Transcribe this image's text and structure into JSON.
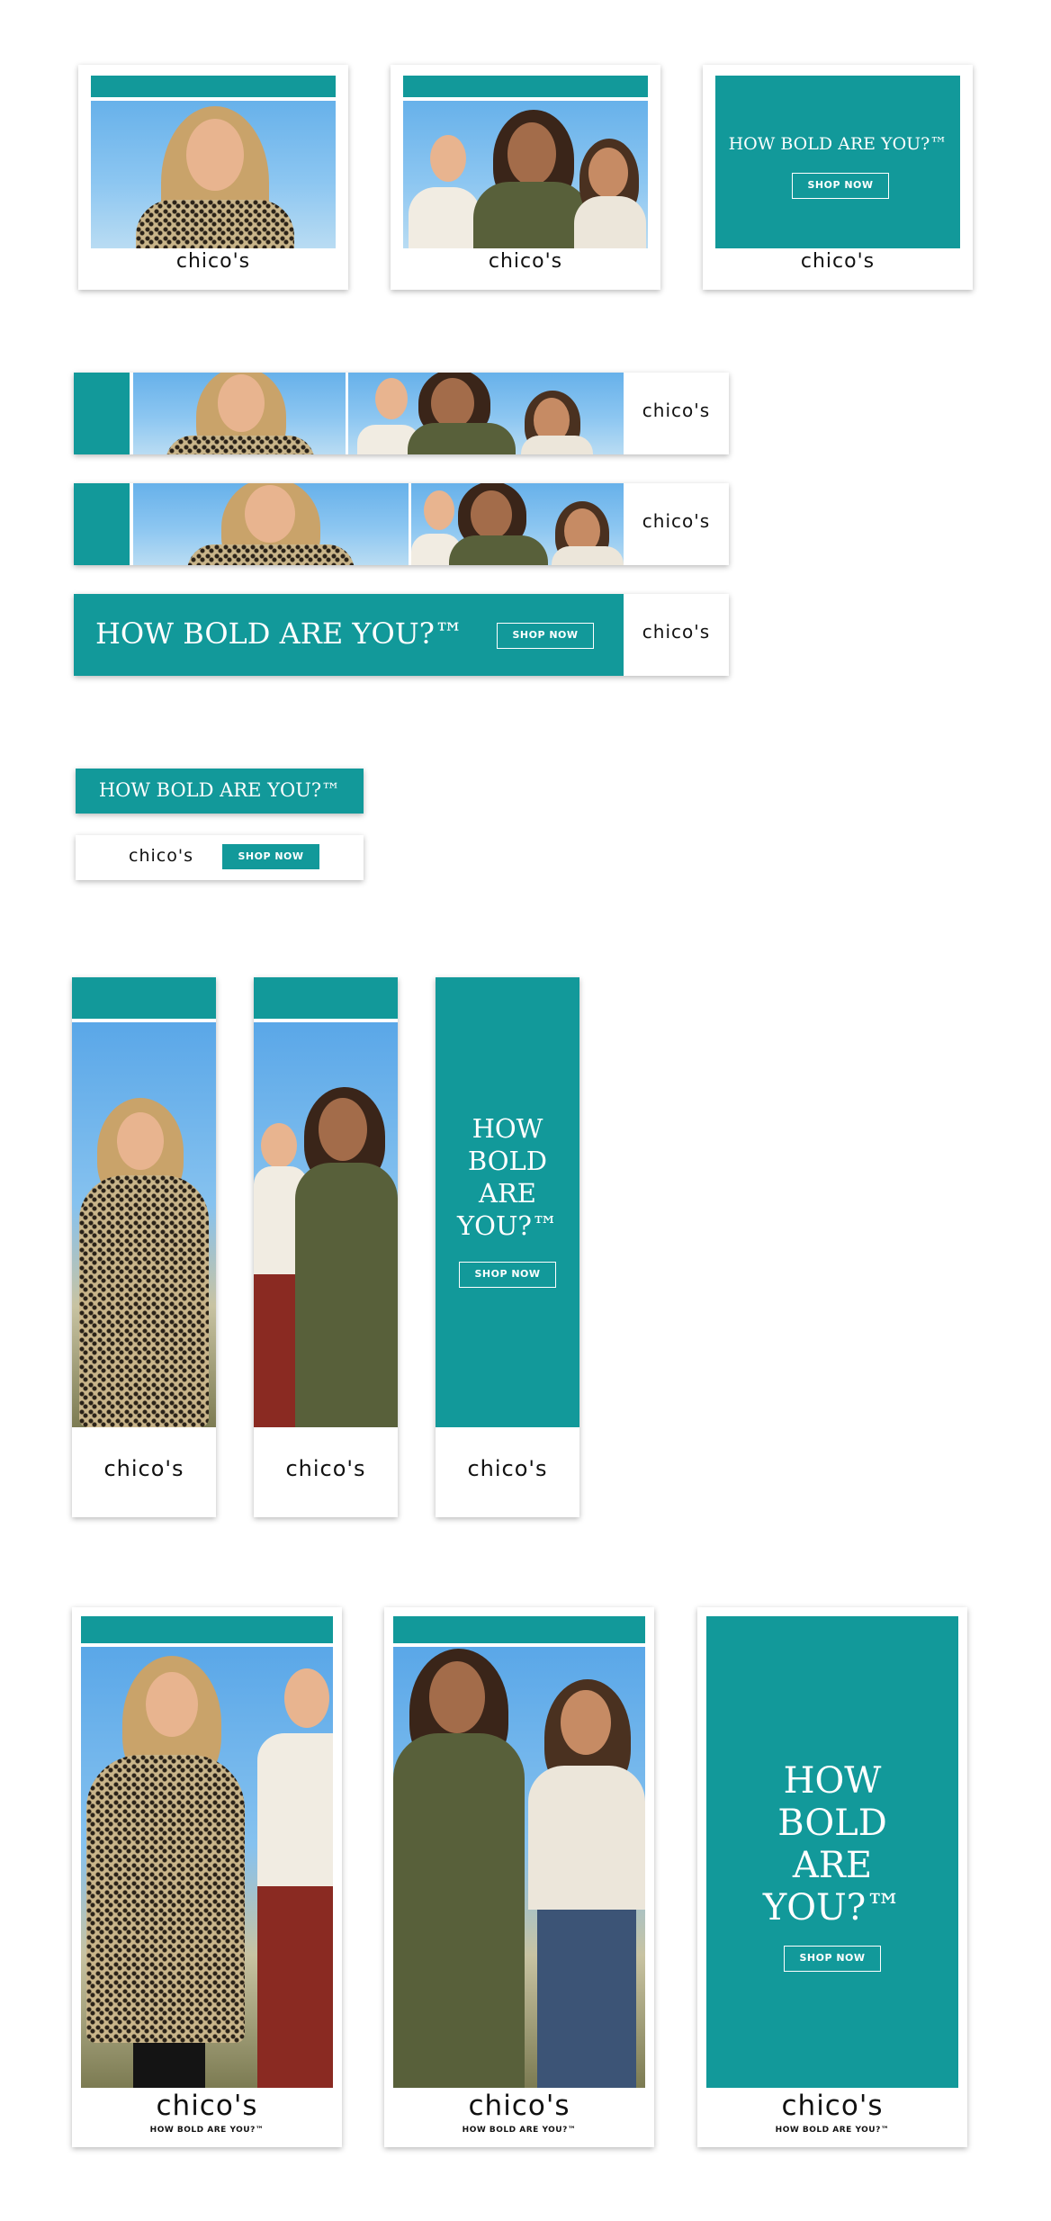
{
  "brand": {
    "logo": "chico's",
    "tagline": "HOW BOLD ARE YOU?™"
  },
  "campaign": {
    "headline": "HOW BOLD ARE YOU?™",
    "headline_words": [
      "HOW",
      "BOLD",
      "ARE",
      "YOU?™"
    ],
    "cta": "SHOP NOW"
  },
  "colors": {
    "teal": "#12999a",
    "white": "#ffffff",
    "text": "#111111"
  },
  "banners": [
    {
      "id": "300x250-photo-1",
      "content": "portrait-leopard"
    },
    {
      "id": "300x250-photo-2",
      "content": "group-three-women"
    },
    {
      "id": "300x250-text",
      "content": "headline-cta"
    },
    {
      "id": "728x90-photos-a",
      "content": "two-photos"
    },
    {
      "id": "728x90-photos-b",
      "content": "two-photos"
    },
    {
      "id": "728x90-text",
      "content": "headline-cta"
    },
    {
      "id": "320x50-headline",
      "content": "headline"
    },
    {
      "id": "320x50-cta",
      "content": "logo-cta"
    },
    {
      "id": "160x600-photo-1",
      "content": "leopard-dress"
    },
    {
      "id": "160x600-photo-2",
      "content": "two-women"
    },
    {
      "id": "160x600-text",
      "content": "headline-cta"
    },
    {
      "id": "300x600-photo-1",
      "content": "two-women-walking"
    },
    {
      "id": "300x600-photo-2",
      "content": "two-women-walking"
    },
    {
      "id": "300x600-text",
      "content": "headline-cta"
    }
  ]
}
